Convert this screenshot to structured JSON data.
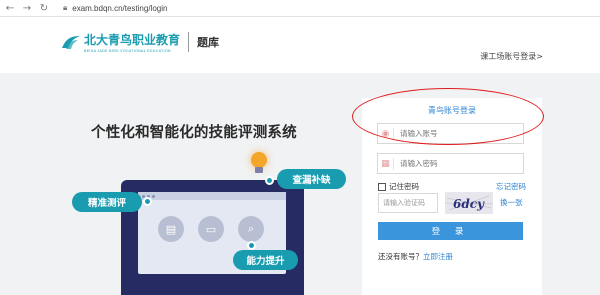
{
  "browser": {
    "url": "exam.bdqn.cn/testing/login"
  },
  "header": {
    "logo_cn": "北大青鸟职业教育",
    "logo_en": "BEIDA JADE BIRD VOCATIONAL EDUCATION",
    "section": "题库",
    "link": "课工场账号登录>"
  },
  "hero": {
    "slogan": "个性化和智能化的技能评测系统",
    "pills": {
      "precise": "精准测评",
      "gaps": "查漏补缺",
      "improve": "能力提升"
    }
  },
  "login": {
    "tab": "青鸟账号登录",
    "account_placeholder": "请输入账号",
    "password_placeholder": "请输入密码",
    "remember": "记住密码",
    "forgot": "忘记密码",
    "captcha_placeholder": "请输入验证码",
    "captcha_text": "6dcy",
    "refresh": "换一张",
    "submit": "登 录",
    "no_account": "还没有账号？",
    "register": "立即注册"
  },
  "colors": {
    "brand": "#1a9cb0",
    "link": "#2b83d2",
    "button": "#3b95dd",
    "laptop": "#262c63",
    "annotation": "#e21d1d"
  }
}
